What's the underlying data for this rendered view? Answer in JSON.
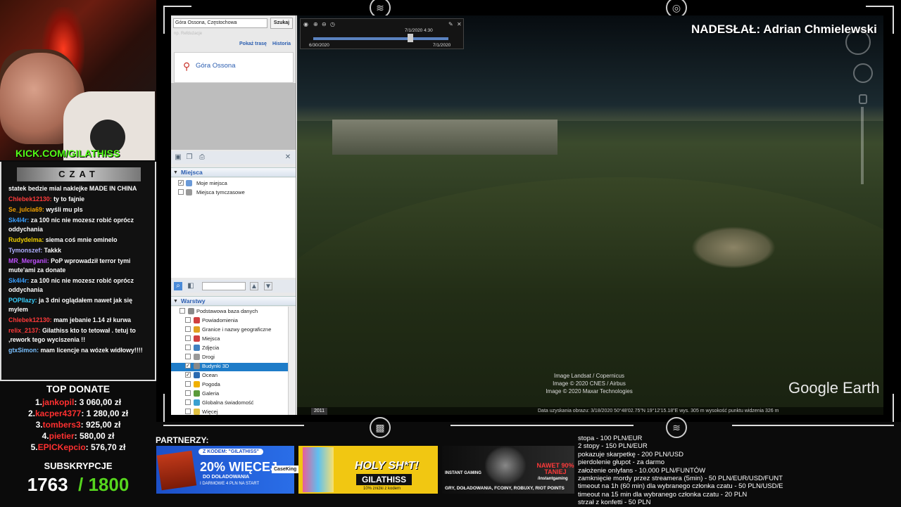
{
  "overlay": {
    "kick_url": "KICK.COM/GILATHISS",
    "chat_title": "CZAT",
    "nadeslal": "NADESŁAŁ: Adrian Chmielewski",
    "partners_label": "PARTNERZY:"
  },
  "chat": [
    {
      "user": "",
      "text": "statek bedzie mial naklejke MADE IN CHINA",
      "color": "#ffffff"
    },
    {
      "user": "Chlebek12130:",
      "text": "ty to fajnie",
      "color": "#ff3a3a"
    },
    {
      "user": "Se_julcia69:",
      "text": "wyśli mu pls",
      "color": "#f0a000"
    },
    {
      "user": "Sk4l4r:",
      "text": "za 100 nic nie mozesz robić oprócz oddychania",
      "color": "#3aa0ff"
    },
    {
      "user": "Rudydelma:",
      "text": "siema coś mnie ominelo",
      "color": "#f0d000"
    },
    {
      "user": "Tymonszef:",
      "text": "Takkk",
      "color": "#b0b0ff"
    },
    {
      "user": "MR_Merganii:",
      "text": "PoP wprowadził terror tymi mute'ami za donate",
      "color": "#c050ff"
    },
    {
      "user": "Sk4l4r:",
      "text": "za 100 nic nie mozesz robić oprócz oddychania",
      "color": "#3aa0ff"
    },
    {
      "user": "POPllazy:",
      "text": "ja 3 dni oglądałem nawet jak się mylem",
      "color": "#3ad0ff"
    },
    {
      "user": "Chlebek12130:",
      "text": "mam jebanie 1.14 zł kurwa",
      "color": "#ff3a3a"
    },
    {
      "user": "relix_2137:",
      "text": "Gilathiss kto to tetował . tetuj to ,rework tego wyciszenia !!",
      "color": "#ff3a3a"
    },
    {
      "user": "gtxSimon:",
      "text": "mam licencje na wózek widłowy!!!!",
      "color": "#7ac0ff"
    }
  ],
  "top_donate": {
    "title": "TOP DONATE",
    "rows": [
      {
        "rank": "1.",
        "name": "jankopil",
        "amount": ": 3 060,00 zł"
      },
      {
        "rank": "2.",
        "name": "kacper4377",
        "amount": ": 1 280,00 zł"
      },
      {
        "rank": "3.",
        "name": "tombers3",
        "amount": ": 925,00 zł"
      },
      {
        "rank": "4.",
        "name": "pietier",
        "amount": ": 580,00 zł"
      },
      {
        "rank": "5.",
        "name": "EPICKepcio",
        "amount": ": 576,70 zł"
      }
    ]
  },
  "subs": {
    "title": "SUBSKRYPCJE",
    "current": "1763",
    "goal": "/ 1800"
  },
  "earth": {
    "search_value": "Góra Ossona, Częstochowa",
    "search_button": "Szukaj",
    "hint": "np. Refdużacje",
    "route_link": "Pokaż trasę",
    "history_link": "Historia",
    "result": "Góra Ossona",
    "places_header": "Miejsca",
    "places": [
      "Moje miejsca",
      "Miejsca tymczasowe"
    ],
    "layers_header": "Warstwy",
    "layers": [
      "Podstawowa baza danych",
      "Powiadomienia",
      "Granice i nazwy geograficzne",
      "Miejsca",
      "Zdjęcia",
      "Drogi",
      "Budynki 3D",
      "Ocean",
      "Pogoda",
      "Galeria",
      "Globalna świadomość",
      "Więcej"
    ],
    "timeline": {
      "current": "7/1/2020  4:30",
      "start": "6/30/2020",
      "end": "7/1/2020"
    },
    "credits": [
      "Image Landsat / Copernicus",
      "Image © 2020 CNES / Airbus",
      "Image © 2020 Maxar Technologies"
    ],
    "brand": "Google Earth",
    "year_badge": "2011",
    "status": "Data uzyskania obrazu: 3/18/2020      50°48'02.75\"N      19°12'15.18\"E   wys.  305 m          wysokość punktu widzenia    326 m"
  },
  "ads": {
    "ad1": {
      "code": "Z KODEM: \"GILATHISS\"",
      "big": "20% WIĘCEJ",
      "sub": "DO DOŁADOWANIA",
      "small": "I DARMOWE 4 PLN NA START",
      "brand": "CaseKing"
    },
    "ad2": {
      "title": "HOLY SH*T!",
      "code": "GILATHISS",
      "small": "10% zniżki z kodem"
    },
    "ad3": {
      "brand": "INSTANT GAMING",
      "promo": "NAWET 90% TANIEJ",
      "code": "/instantgaming",
      "tagline": "GRY, DOŁADOWANIA, FCOINY, ROBUXY, RIOT POINTS"
    }
  },
  "prices": [
    "stopa - 100 PLN/EUR",
    "2 stopy - 150 PLN/EUR",
    "pokazuje skarpetkę - 200 PLN/USD",
    "pierdolenie głupot - za darmo",
    "założenie onlyfans - 10.000 PLN/FUNTÓW",
    "zamknięcie mordy przez streamera (5min) - 50 PLN/EUR/USD/FUNT",
    "timeout na 1h (60 min) dla wybranego członka czatu - 50 PLN/USD/E",
    "timeout na 15 min dla wybranego członka czatu - 20 PLN",
    "strzał z konfetti - 50 PLN"
  ]
}
